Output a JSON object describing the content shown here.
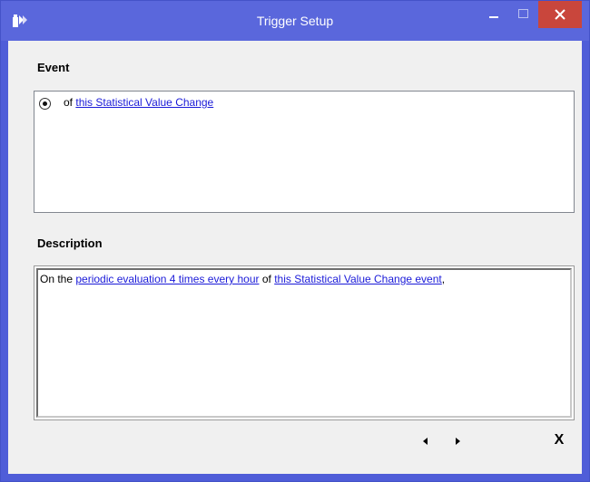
{
  "window": {
    "title": "Trigger Setup"
  },
  "icons": {
    "app": "trigger-app-icon",
    "minimize": "minimize-icon",
    "maximize": "maximize-icon",
    "close": "close-icon",
    "prev": "triangle-left-icon",
    "next": "triangle-right-icon"
  },
  "colors": {
    "titlebar": "#5a67dc",
    "close_button": "#c9463c",
    "link": "#1a1ad8",
    "client_bg": "#f0f0f0"
  },
  "event": {
    "label": "Event",
    "option": {
      "selected": true,
      "prefix": "of",
      "link": "this Statistical Value Change"
    }
  },
  "description": {
    "label": "Description",
    "text_1": "On the",
    "link_1": "periodic evaluation 4 times every hour",
    "text_2": "of",
    "link_2": "this Statistical Value Change event",
    "text_3": ","
  },
  "footer": {
    "close_label": "X"
  }
}
